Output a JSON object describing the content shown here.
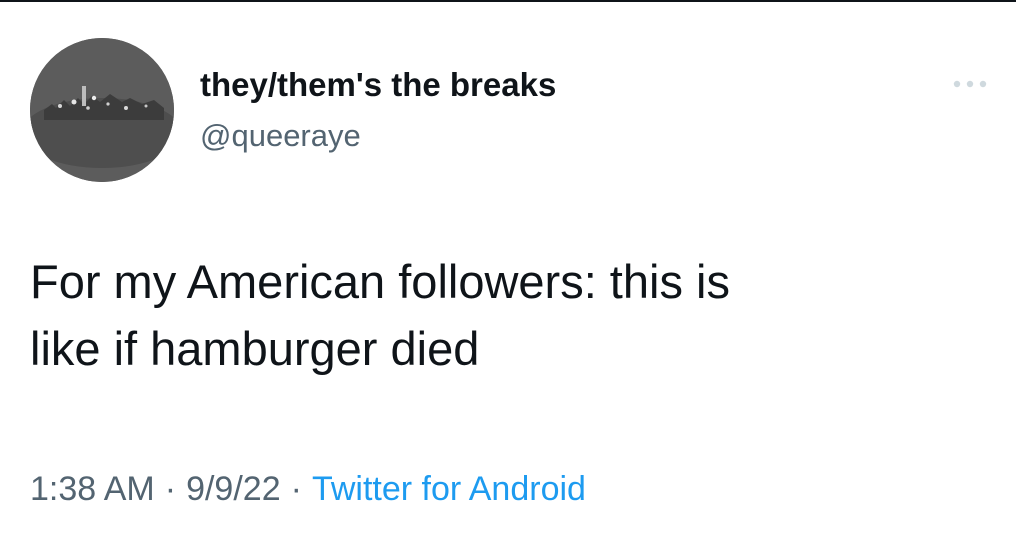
{
  "author": {
    "display_name": "they/them's the breaks",
    "handle": "@queeraye"
  },
  "tweet": {
    "text_lines": [
      "For my American followers: this is",
      "like if hamburger died"
    ]
  },
  "meta": {
    "time": "1:38 AM",
    "separator": "·",
    "date": "9/9/22",
    "source": "Twitter for Android"
  },
  "icons": {
    "more": "more-horizontal-icon",
    "avatar": "profile-photo"
  },
  "colors": {
    "text": "#0f1419",
    "secondary": "#536471",
    "link": "#1d9bf0",
    "background": "#ffffff"
  }
}
